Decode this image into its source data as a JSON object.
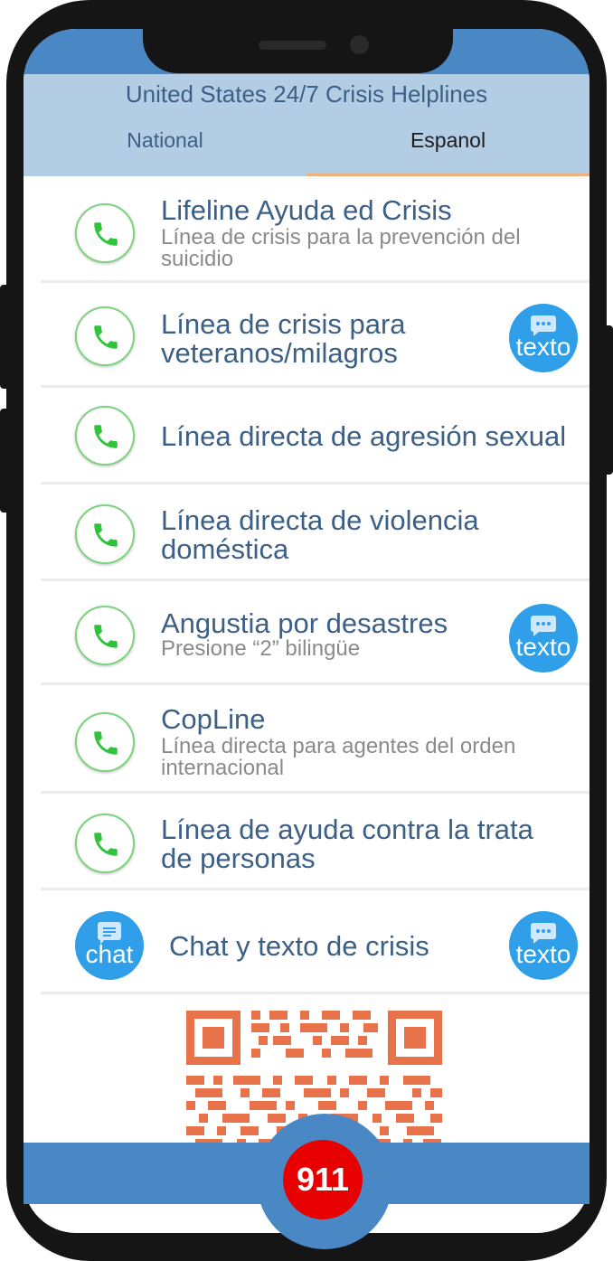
{
  "app": {
    "title": "United States 24/7 Crisis Helplines",
    "tabs": [
      {
        "label": "National",
        "active": false
      },
      {
        "label": "Espanol",
        "active": true
      }
    ]
  },
  "colors": {
    "topbar": "#4a88c5",
    "header": "#b3cde5",
    "title_text": "#3c5f86",
    "phone_ring": "#7ed37e",
    "phone_icon": "#2fc43a",
    "bubble": "#2e9fe8",
    "qr": "#e8734a",
    "emergency": "#e80000",
    "tab_underline": "#f0b07c"
  },
  "rows": [
    {
      "title": "Lifeline Ayuda ed Crisis",
      "subtitle": "Línea de crisis para la prevención del suicidio",
      "text_button": null,
      "icon": "phone-icon"
    },
    {
      "title": "Línea de crisis para veteranos/milagros",
      "subtitle": null,
      "text_button": "texto",
      "icon": "phone-icon"
    },
    {
      "title": "Línea directa de agresión sexual",
      "subtitle": null,
      "text_button": null,
      "icon": "phone-icon"
    },
    {
      "title": "Línea directa de violencia doméstica",
      "subtitle": null,
      "text_button": null,
      "icon": "phone-icon"
    },
    {
      "title": "Angustia por desastres",
      "subtitle": "Presione “2” bilingüe",
      "text_button": "texto",
      "icon": "phone-icon"
    },
    {
      "title": "CopLine",
      "subtitle": "Línea directa para agentes del orden internacional",
      "text_button": null,
      "icon": "phone-icon"
    },
    {
      "title": "Línea de ayuda contra la trata de personas",
      "subtitle": null,
      "text_button": null,
      "icon": "phone-icon"
    },
    {
      "title": "Chat y texto de crisis",
      "subtitle": null,
      "chat_button": "chat",
      "text_button": "texto",
      "icon": "chat-icon"
    }
  ],
  "emergency_button": "911"
}
